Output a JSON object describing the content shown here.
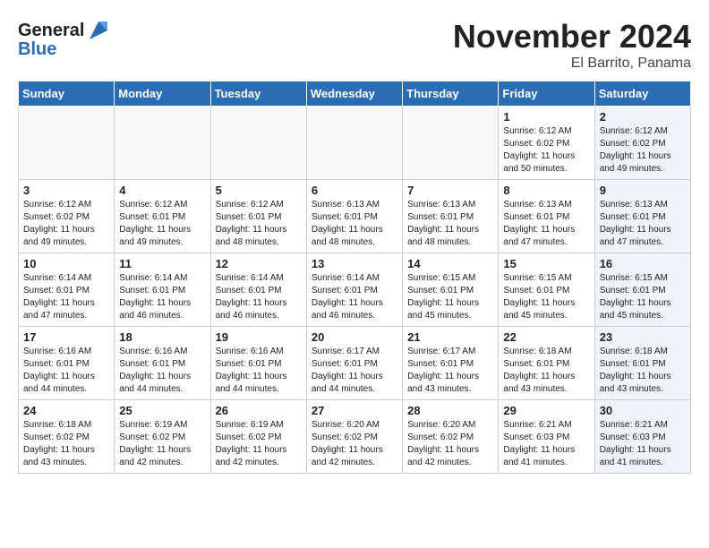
{
  "header": {
    "logo_line1": "General",
    "logo_line2": "Blue",
    "month_title": "November 2024",
    "location": "El Barrito, Panama"
  },
  "weekdays": [
    "Sunday",
    "Monday",
    "Tuesday",
    "Wednesday",
    "Thursday",
    "Friday",
    "Saturday"
  ],
  "weeks": [
    [
      {
        "day": "",
        "content": "",
        "shaded": false,
        "empty": true
      },
      {
        "day": "",
        "content": "",
        "shaded": false,
        "empty": true
      },
      {
        "day": "",
        "content": "",
        "shaded": false,
        "empty": true
      },
      {
        "day": "",
        "content": "",
        "shaded": false,
        "empty": true
      },
      {
        "day": "",
        "content": "",
        "shaded": false,
        "empty": true
      },
      {
        "day": "1",
        "content": "Sunrise: 6:12 AM\nSunset: 6:02 PM\nDaylight: 11 hours\nand 50 minutes.",
        "shaded": false,
        "empty": false
      },
      {
        "day": "2",
        "content": "Sunrise: 6:12 AM\nSunset: 6:02 PM\nDaylight: 11 hours\nand 49 minutes.",
        "shaded": true,
        "empty": false
      }
    ],
    [
      {
        "day": "3",
        "content": "Sunrise: 6:12 AM\nSunset: 6:02 PM\nDaylight: 11 hours\nand 49 minutes.",
        "shaded": false,
        "empty": false
      },
      {
        "day": "4",
        "content": "Sunrise: 6:12 AM\nSunset: 6:01 PM\nDaylight: 11 hours\nand 49 minutes.",
        "shaded": false,
        "empty": false
      },
      {
        "day": "5",
        "content": "Sunrise: 6:12 AM\nSunset: 6:01 PM\nDaylight: 11 hours\nand 48 minutes.",
        "shaded": false,
        "empty": false
      },
      {
        "day": "6",
        "content": "Sunrise: 6:13 AM\nSunset: 6:01 PM\nDaylight: 11 hours\nand 48 minutes.",
        "shaded": false,
        "empty": false
      },
      {
        "day": "7",
        "content": "Sunrise: 6:13 AM\nSunset: 6:01 PM\nDaylight: 11 hours\nand 48 minutes.",
        "shaded": false,
        "empty": false
      },
      {
        "day": "8",
        "content": "Sunrise: 6:13 AM\nSunset: 6:01 PM\nDaylight: 11 hours\nand 47 minutes.",
        "shaded": false,
        "empty": false
      },
      {
        "day": "9",
        "content": "Sunrise: 6:13 AM\nSunset: 6:01 PM\nDaylight: 11 hours\nand 47 minutes.",
        "shaded": true,
        "empty": false
      }
    ],
    [
      {
        "day": "10",
        "content": "Sunrise: 6:14 AM\nSunset: 6:01 PM\nDaylight: 11 hours\nand 47 minutes.",
        "shaded": false,
        "empty": false
      },
      {
        "day": "11",
        "content": "Sunrise: 6:14 AM\nSunset: 6:01 PM\nDaylight: 11 hours\nand 46 minutes.",
        "shaded": false,
        "empty": false
      },
      {
        "day": "12",
        "content": "Sunrise: 6:14 AM\nSunset: 6:01 PM\nDaylight: 11 hours\nand 46 minutes.",
        "shaded": false,
        "empty": false
      },
      {
        "day": "13",
        "content": "Sunrise: 6:14 AM\nSunset: 6:01 PM\nDaylight: 11 hours\nand 46 minutes.",
        "shaded": false,
        "empty": false
      },
      {
        "day": "14",
        "content": "Sunrise: 6:15 AM\nSunset: 6:01 PM\nDaylight: 11 hours\nand 45 minutes.",
        "shaded": false,
        "empty": false
      },
      {
        "day": "15",
        "content": "Sunrise: 6:15 AM\nSunset: 6:01 PM\nDaylight: 11 hours\nand 45 minutes.",
        "shaded": false,
        "empty": false
      },
      {
        "day": "16",
        "content": "Sunrise: 6:15 AM\nSunset: 6:01 PM\nDaylight: 11 hours\nand 45 minutes.",
        "shaded": true,
        "empty": false
      }
    ],
    [
      {
        "day": "17",
        "content": "Sunrise: 6:16 AM\nSunset: 6:01 PM\nDaylight: 11 hours\nand 44 minutes.",
        "shaded": false,
        "empty": false
      },
      {
        "day": "18",
        "content": "Sunrise: 6:16 AM\nSunset: 6:01 PM\nDaylight: 11 hours\nand 44 minutes.",
        "shaded": false,
        "empty": false
      },
      {
        "day": "19",
        "content": "Sunrise: 6:16 AM\nSunset: 6:01 PM\nDaylight: 11 hours\nand 44 minutes.",
        "shaded": false,
        "empty": false
      },
      {
        "day": "20",
        "content": "Sunrise: 6:17 AM\nSunset: 6:01 PM\nDaylight: 11 hours\nand 44 minutes.",
        "shaded": false,
        "empty": false
      },
      {
        "day": "21",
        "content": "Sunrise: 6:17 AM\nSunset: 6:01 PM\nDaylight: 11 hours\nand 43 minutes.",
        "shaded": false,
        "empty": false
      },
      {
        "day": "22",
        "content": "Sunrise: 6:18 AM\nSunset: 6:01 PM\nDaylight: 11 hours\nand 43 minutes.",
        "shaded": false,
        "empty": false
      },
      {
        "day": "23",
        "content": "Sunrise: 6:18 AM\nSunset: 6:01 PM\nDaylight: 11 hours\nand 43 minutes.",
        "shaded": true,
        "empty": false
      }
    ],
    [
      {
        "day": "24",
        "content": "Sunrise: 6:18 AM\nSunset: 6:02 PM\nDaylight: 11 hours\nand 43 minutes.",
        "shaded": false,
        "empty": false
      },
      {
        "day": "25",
        "content": "Sunrise: 6:19 AM\nSunset: 6:02 PM\nDaylight: 11 hours\nand 42 minutes.",
        "shaded": false,
        "empty": false
      },
      {
        "day": "26",
        "content": "Sunrise: 6:19 AM\nSunset: 6:02 PM\nDaylight: 11 hours\nand 42 minutes.",
        "shaded": false,
        "empty": false
      },
      {
        "day": "27",
        "content": "Sunrise: 6:20 AM\nSunset: 6:02 PM\nDaylight: 11 hours\nand 42 minutes.",
        "shaded": false,
        "empty": false
      },
      {
        "day": "28",
        "content": "Sunrise: 6:20 AM\nSunset: 6:02 PM\nDaylight: 11 hours\nand 42 minutes.",
        "shaded": false,
        "empty": false
      },
      {
        "day": "29",
        "content": "Sunrise: 6:21 AM\nSunset: 6:03 PM\nDaylight: 11 hours\nand 41 minutes.",
        "shaded": false,
        "empty": false
      },
      {
        "day": "30",
        "content": "Sunrise: 6:21 AM\nSunset: 6:03 PM\nDaylight: 11 hours\nand 41 minutes.",
        "shaded": true,
        "empty": false
      }
    ]
  ]
}
